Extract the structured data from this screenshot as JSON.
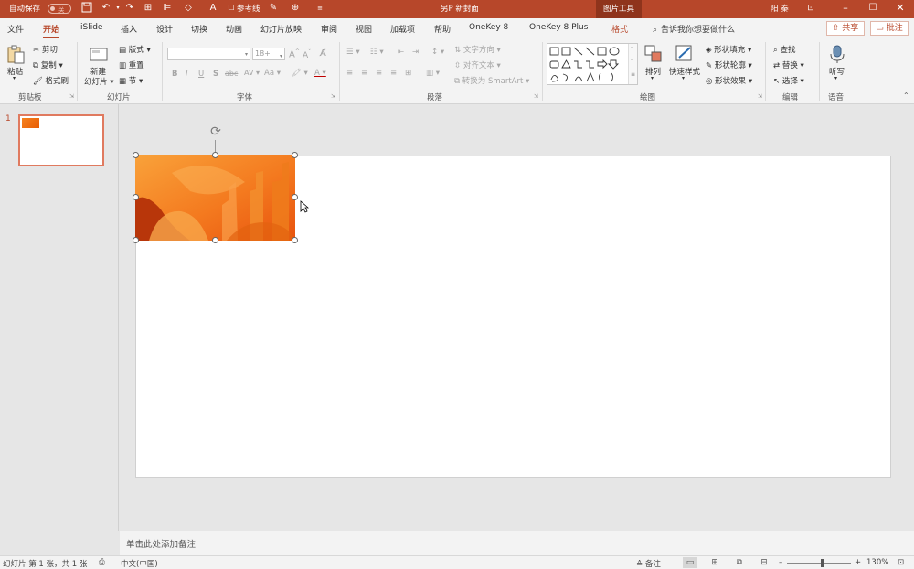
{
  "titlebar": {
    "autosave_label": "自动保存",
    "autosave_state": "关",
    "document_title": "另P 新封面",
    "context_tool": "图片工具",
    "user": "阳 秦",
    "ref_line_label": "参考线"
  },
  "tabs": [
    "文件",
    "开始",
    "iSlide",
    "插入",
    "设计",
    "切换",
    "动画",
    "幻灯片放映",
    "审阅",
    "视图",
    "加载项",
    "帮助",
    "OneKey 8",
    "OneKey 8 Plus",
    "格式"
  ],
  "active_tab": "开始",
  "tell_me": "告诉我你想要做什么",
  "share_label": "共享",
  "comment_label": "批注",
  "ribbon": {
    "clipboard": {
      "paste": "粘贴",
      "cut": "剪切",
      "copy": "复制",
      "format_painter": "格式刷",
      "label": "剪贴板"
    },
    "slides": {
      "new_slide_line1": "新建",
      "new_slide_line2": "幻灯片",
      "layout": "版式",
      "reset": "重置",
      "section": "节",
      "label": "幻灯片"
    },
    "font": {
      "size": "18+",
      "label": "字体",
      "bold": "B",
      "italic": "I",
      "underline": "U",
      "strike": "S",
      "shadow": "abc",
      "spacing": "AV",
      "case": "Aa",
      "grow": "A",
      "shrink": "A"
    },
    "paragraph": {
      "text_direction": "文字方向",
      "align_text": "对齐文本",
      "smartart": "转换为 SmartArt",
      "label": "段落"
    },
    "drawing": {
      "arrange": "排列",
      "quick_styles": "快速样式",
      "shape_fill": "形状填充",
      "shape_outline": "形状轮廓",
      "shape_effects": "形状效果",
      "label": "绘图"
    },
    "editing": {
      "find": "查找",
      "replace": "替换",
      "select": "选择",
      "label": "编辑"
    },
    "voice": {
      "dictate": "听写",
      "label": "语音"
    }
  },
  "thumbnails": [
    {
      "number": "1"
    }
  ],
  "notes_placeholder": "单击此处添加备注",
  "status": {
    "slide_info": "幻灯片 第 1 张，共 1 张",
    "language": "中文(中国)",
    "notes": "备注",
    "zoom": "130%"
  },
  "colors": {
    "accent": "#b7472a",
    "picture": "#f47a1f"
  }
}
